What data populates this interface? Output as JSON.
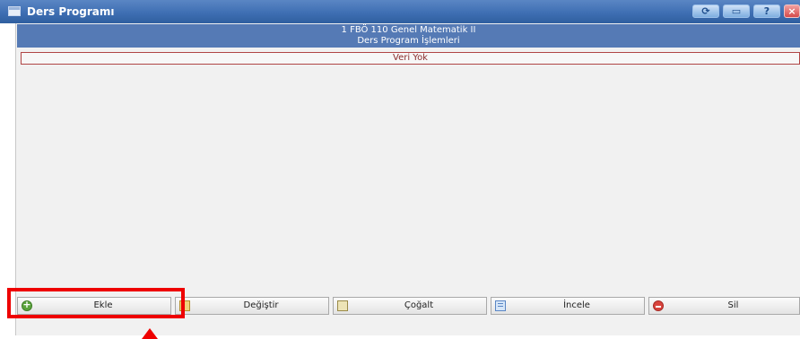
{
  "window": {
    "title": "Ders Programı",
    "buttons": {
      "refresh": "⟳",
      "restore": "▭",
      "help": "?",
      "close": "×"
    }
  },
  "header": {
    "line1": "1 FBÖ 110 Genel Matematik II",
    "line2": "Ders Program İşlemleri"
  },
  "empty_message": "Veri Yok",
  "actions": [
    {
      "label": "Ekle",
      "icon": "add-icon"
    },
    {
      "label": "Değiştir",
      "icon": "edit-icon"
    },
    {
      "label": "Çoğalt",
      "icon": "copy-icon"
    },
    {
      "label": "İncele",
      "icon": "view-icon"
    },
    {
      "label": "Sil",
      "icon": "delete-icon"
    }
  ],
  "colors": {
    "titlebar": "#3f6fb3",
    "header": "#557ab5",
    "highlight": "#ee0000",
    "empty_border": "#b04545"
  }
}
